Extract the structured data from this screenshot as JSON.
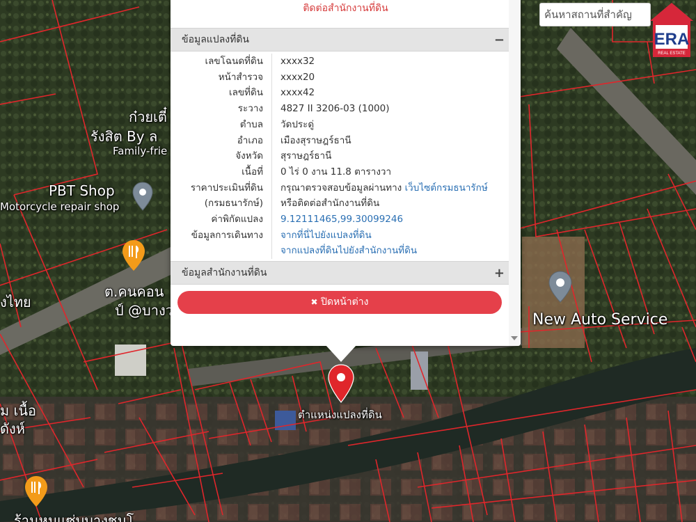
{
  "header": {
    "contact_link": "ติดต่อสำนักงานที่ดิน"
  },
  "search": {
    "placeholder": "ค้นหาสถานที่สำคัญ"
  },
  "logo": {
    "text": "ERA",
    "sub": "REAL ESTATE"
  },
  "land_info": {
    "title": "ข้อมูลแปลงที่ดิน",
    "toggle": "−",
    "rows": [
      {
        "label": "เลขโฉนดที่ดิน",
        "value": "xxxx32"
      },
      {
        "label": "หน้าสำรวจ",
        "value": "xxxx20"
      },
      {
        "label": "เลขที่ดิน",
        "value": "xxxx42"
      },
      {
        "label": "ระวาง",
        "value": "4827 II 3206-03 (1000)"
      },
      {
        "label": "ตำบล",
        "value": "วัดประดู่"
      },
      {
        "label": "อำเภอ",
        "value": "เมืองสุราษฎร์ธานี"
      },
      {
        "label": "จังหวัด",
        "value": "สุราษฎร์ธานี"
      },
      {
        "label": "เนื้อที่",
        "value": "0 ไร่ 0 งาน 11.8 ตารางวา"
      }
    ],
    "appraisal": {
      "label1": "ราคาประเมินที่ดิน",
      "label2": "(กรมธนารักษ์)",
      "text1": "กรุณาตรวจสอบข้อมูลผ่านทาง",
      "link1": "เว็บไซต์กรมธนารักษ์",
      "text2": "หรือติดต่อสำนักงานที่ดิน"
    },
    "coords": {
      "label": "ค่าพิกัดแปลง",
      "value": "9.12111465,99.30099246"
    },
    "travel": {
      "label": "ข้อมูลการเดินทาง",
      "link1": "จากที่นี่ไปยังแปลงที่ดิน",
      "link2": "จากแปลงที่ดินไปยังสำนักงานที่ดิน"
    }
  },
  "office_info": {
    "title": "ข้อมูลสำนักงานที่ดิน",
    "toggle": "+"
  },
  "close_button": {
    "icon": "✖",
    "label": "ปิดหน้าต่าง"
  },
  "map_labels": {
    "kuay_tiew": "ก๋วยเตี๋",
    "rangsit": "รังสิต By ล",
    "family": "Family-frie",
    "pbt_shop": "PBT Shop",
    "motorcycle": "Motorcycle repair shop",
    "cafe": "ต.คนคอน",
    "cafe2": "ป์ @บางว",
    "thai": "งไทย",
    "new_auto": "New Auto Service",
    "parcel_location": "ตำแหน่งแปลงที่ดิน",
    "left_a": "ม เนื้อ",
    "left_b": "ดังห์",
    "bottom": "ร้านหมูแซ่บบางชมโ"
  },
  "colors": {
    "accent": "#e5404a",
    "link": "#2a6fb3",
    "boundary": "#e0262b"
  }
}
